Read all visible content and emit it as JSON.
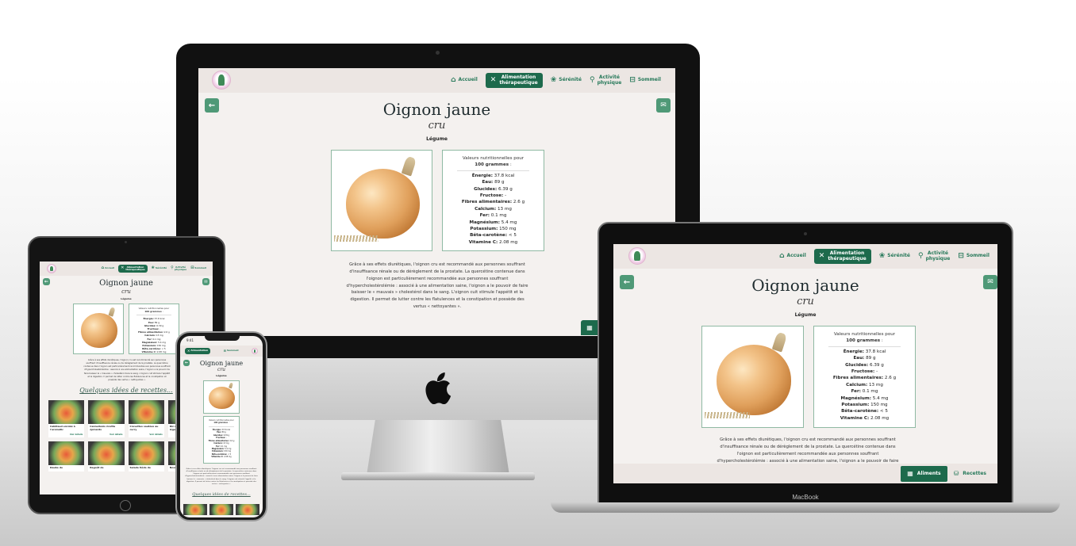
{
  "nav": {
    "home": "Accueil",
    "alim_line1": "Alimentation",
    "alim_line2": "thérapeutique",
    "serenite": "Sérénité",
    "activite_line1": "Activité",
    "activite_line2": "physique",
    "sommeil": "Sommeil"
  },
  "icons": {
    "back": "arrow-left-icon",
    "mail": "mail-icon",
    "home": "home-icon",
    "fork_knife": "fork-knife-icon",
    "lotus": "lotus-icon",
    "runner": "runner-icon",
    "bed": "bed-icon",
    "table": "table-icon",
    "recipes": "recipes-icon",
    "apple_logo": "apple-logo-icon"
  },
  "food": {
    "name": "Oignon jaune",
    "state": "cru",
    "category": "Légume"
  },
  "nutrition": {
    "intro": "Valeurs nutritionnelles pour",
    "per": "100 grammes",
    "rows": [
      {
        "label": "Énergie:",
        "value": "37.8 kcal"
      },
      {
        "label": "Eau:",
        "value": "89 g"
      },
      {
        "label": "Glucides:",
        "value": "6.39 g"
      },
      {
        "label": "Fructose:",
        "value": "-"
      },
      {
        "label": "Fibres alimentaires:",
        "value": "2.6 g"
      },
      {
        "label": "Calcium:",
        "value": "13 mg"
      },
      {
        "label": "Fer:",
        "value": "0.1 mg"
      },
      {
        "label": "Magnésium:",
        "value": "5.4 mg"
      },
      {
        "label": "Potassium:",
        "value": "150 mg"
      },
      {
        "label": "Bêta-carotène:",
        "value": "< 5"
      },
      {
        "label": "Vitamine C:",
        "value": "2.08 mg"
      }
    ]
  },
  "description": {
    "full": "Grâce à ses effets diurétiques, l'oignon cru est recommandé aux personnes souffrant d'insuffisance rénale ou de dérèglement de la prostate. La quercétine contenue dans l'oignon est particulièrement recommandée aux personnes souffrant d'hypercholestérolémie : associé à une alimentation saine, l'oignon a le pouvoir de faire baisser le « mauvais » cholestérol dans le sang. L'oignon cuit stimule l'appétit et la digestion. Il permet de lutter contre les flatulences et la constipation et possède des vertus « nettoyantes ».",
    "laptop_visible": "Grâce à ses effets diurétiques, l'oignon cru est recommandé aux personnes souffrant d'insuffisance rénale ou de dérèglement de la prostate. La quercétine contenue dans l'oignon est particulièrement recommandée aux personnes souffrant d'hypercholestérolémie : associé à une alimentation saine, l'oignon a le pouvoir de faire"
  },
  "tabs": {
    "aliments": "Aliments",
    "recettes": "Recettes"
  },
  "recipes": {
    "heading": "Quelques idées de recettes...",
    "cards": [
      {
        "title": "Cabillaud enrobé à l'aromatic",
        "cta": "Voir détails"
      },
      {
        "title": "Cannellonis ricotta épinards",
        "cta": "Voir détails"
      },
      {
        "title": "Crevettes sautées au curry",
        "cta": "Voir détails"
      },
      {
        "title": "Riz aux lentilles et aux légumes",
        "cta": "Voir détails"
      },
      {
        "title": "Daube de",
        "cta": ""
      },
      {
        "title": "Ragoût de",
        "cta": ""
      },
      {
        "title": "Salade tiède de",
        "cta": ""
      },
      {
        "title": "Nouilles sautés",
        "cta": ""
      }
    ]
  },
  "phone": {
    "time": "9:41"
  },
  "laptop_brand": "MacBook",
  "colors": {
    "accent": "#1d6a4c",
    "accent_light": "#4f9977",
    "text_green": "#27795a",
    "page_bg": "#f4f1ef",
    "header_bg": "#ece6e3"
  }
}
